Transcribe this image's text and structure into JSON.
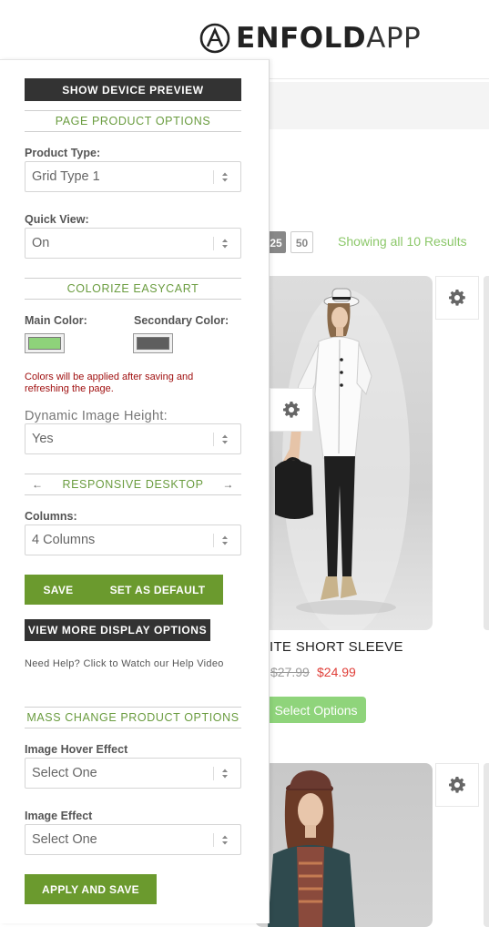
{
  "brand": {
    "name_bold": "ENFOLD",
    "name_light": "APP"
  },
  "listing": {
    "per_page": [
      "25",
      "50"
    ],
    "showing_text": "Showing all 10 Results"
  },
  "product1": {
    "title": "ITE SHORT SLEEVE",
    "price_old": "$27.99",
    "price_new": "$24.99",
    "button": "Select Options"
  },
  "panel": {
    "device_preview_button": "SHOW DEVICE PREVIEW",
    "page_product_options": {
      "heading": "PAGE PRODUCT OPTIONS",
      "product_type_label": "Product Type:",
      "product_type_value": "Grid Type 1",
      "quick_view_label": "Quick View:",
      "quick_view_value": "On"
    },
    "colorize": {
      "heading": "COLORIZE EASYCART",
      "main_color_label": "Main Color:",
      "secondary_color_label": "Secondary Color:",
      "main_color": "#8ed27a",
      "secondary_color": "#5e5e5e",
      "note": "Colors will be applied after saving and refreshing the page.",
      "dynamic_height_label": "Dynamic Image Height:",
      "dynamic_height_value": "Yes"
    },
    "responsive": {
      "heading": "RESPONSIVE DESKTOP",
      "prev_arrow": "←",
      "next_arrow": "→",
      "columns_label": "Columns:",
      "columns_value": "4 Columns",
      "save_button": "SAVE",
      "default_button": "SET AS DEFAULT"
    },
    "view_more_button": "VIEW MORE DISPLAY OPTIONS",
    "help_text": "Need Help? Click to Watch our Help Video",
    "mass_change": {
      "heading": "MASS CHANGE PRODUCT OPTIONS",
      "hover_label": "Image Hover Effect",
      "hover_value": "Select One",
      "effect_label": "Image Effect",
      "effect_value": "Select One",
      "apply_button": "APPLY AND SAVE"
    }
  },
  "colors": {
    "accent_green": "#6b9a2e",
    "heading_green": "#6a9c3f",
    "note_red": "#a01010"
  }
}
